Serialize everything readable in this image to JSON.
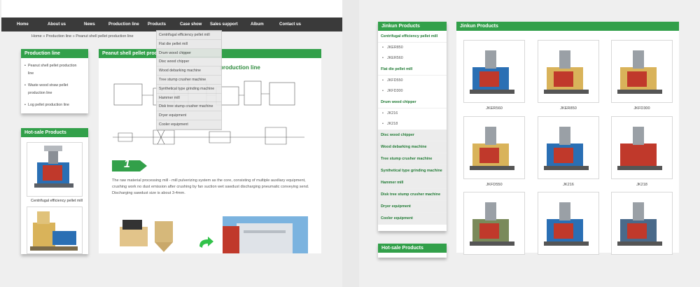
{
  "nav": [
    "Home",
    "About us",
    "News",
    "Production line",
    "Products",
    "Case show",
    "Sales support",
    "Album",
    "Contact us"
  ],
  "breadcrumb": "Home » Production line » Peanut shell pellet production line",
  "left_sidebar": {
    "production_line_title": "Production line",
    "production_line_items": [
      "Peanut shell pellet production line",
      "Waste wood straw pellet production line",
      "Log pellet production line"
    ],
    "hot_sale_title": "Hot-sale Products",
    "hot_sale_caption": "Centrifugal efficiency pellet mill"
  },
  "main": {
    "title": "Peanut shell pellet production line",
    "diagram_heading": "production line",
    "step_number": "1",
    "description": "The raw material processing mill - mill pulverizing system as the core, consisting of multiple auxiliary equipment, crushing work no dust emission after crushing by fan suction wet sawdust discharging pneumatic conveying send. Discharging sawdust size is about 3-4mm."
  },
  "dropdown": [
    "Centrifugal efficiency pellet mill",
    "Flat die pellet mill",
    "Drum wood chipper",
    "Disc wood chipper",
    "Wood debarking machine",
    "Tree stump crusher machine",
    "Synthetical type grinding machine",
    "Hammer mill",
    "Disk tree stump crusher machine",
    "Dryer equipment",
    "Cooler equipment"
  ],
  "right": {
    "sidebar_title": "Jinkun Products",
    "main_title": "Jinkun Products",
    "hot_sale_title": "Hot-sale Products",
    "categories": [
      {
        "name": "Centrifugal efficiency pellet mill",
        "items": [
          "JKER850",
          "JKER560"
        ]
      },
      {
        "name": "Flat die pellet mill",
        "items": [
          "JKFD550",
          "JKFD300"
        ]
      },
      {
        "name": "Drum wood chipper",
        "items": [
          "JK216",
          "JK218"
        ]
      },
      {
        "name": "Disc wood chipper",
        "items": []
      },
      {
        "name": "Wood debarking machine",
        "items": []
      },
      {
        "name": "Tree stump crusher machine",
        "items": []
      },
      {
        "name": "Synthetical type grinding machine",
        "items": []
      },
      {
        "name": "Hammer mill",
        "items": []
      },
      {
        "name": "Disk tree stump crusher machine",
        "items": []
      },
      {
        "name": "Dryer equipment",
        "items": []
      },
      {
        "name": "Cooler equipment",
        "items": []
      }
    ],
    "products": [
      "JKER560",
      "JKER850",
      "JKFD300",
      "JKFD550",
      "JK216",
      "JK218",
      "",
      "",
      ""
    ]
  },
  "colors": {
    "nav_bg": "#3a3a3a",
    "green": "#32a04a",
    "accent_red": "#c0392b",
    "machine_blue": "#2a6fb4",
    "machine_yellow": "#d9b35a"
  }
}
